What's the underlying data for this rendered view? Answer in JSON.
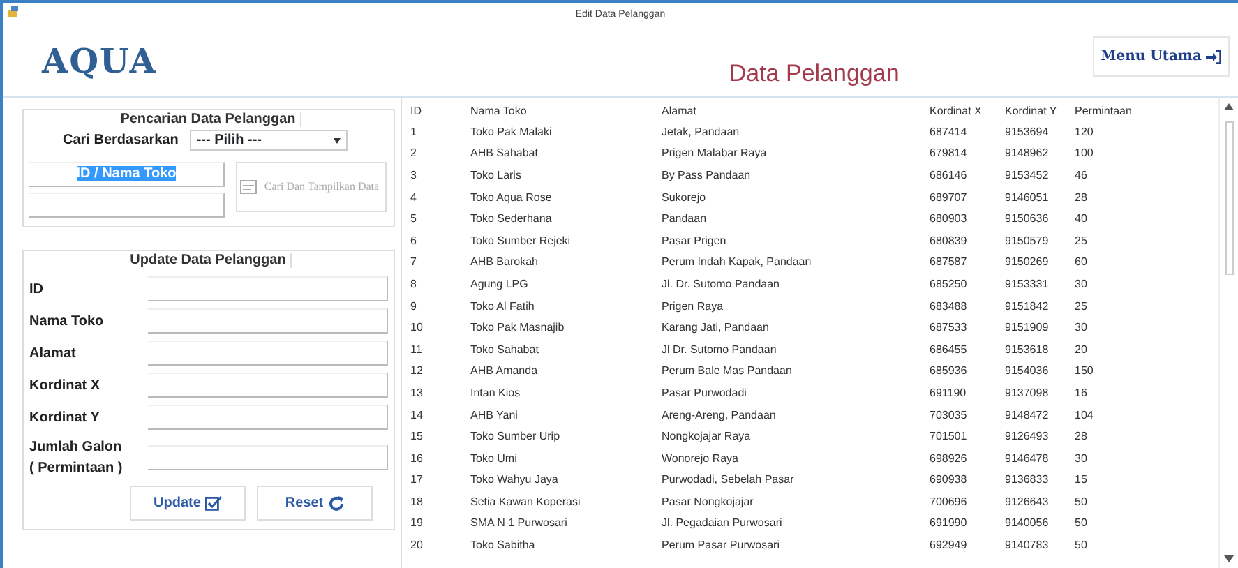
{
  "window": {
    "title": "Edit Data Pelanggan"
  },
  "header": {
    "logo": "AQUA",
    "heading": "Data Pelanggan",
    "menu_button": "Menu Utama"
  },
  "search": {
    "legend": "Pencarian Data Pelanggan",
    "by_label": "Cari Berdasarkan",
    "select_value": "--- Pilih ---",
    "field_value": "ID / Nama Toko",
    "field_selected": true,
    "button_label": "Cari Dan Tampilkan Data",
    "button_disabled": true
  },
  "update": {
    "legend": "Update Data Pelanggan",
    "fields": [
      {
        "label": "ID"
      },
      {
        "label": "Nama Toko"
      },
      {
        "label": "Alamat"
      },
      {
        "label": "Kordinat X"
      },
      {
        "label": "Kordinat Y"
      },
      {
        "label": "Jumlah Galon ( Permintaan )"
      }
    ],
    "buttons": [
      {
        "label": "Update",
        "kind": "update"
      },
      {
        "label": "Reset",
        "kind": "reset"
      }
    ]
  },
  "table": {
    "columns": [
      "ID",
      "Nama Toko",
      "Alamat",
      "Kordinat X",
      "Kordinat Y",
      "Permintaan"
    ],
    "rows": [
      [
        "1",
        "Toko Pak Malaki",
        "Jetak, Pandaan",
        "687414",
        "9153694",
        "120"
      ],
      [
        "2",
        "AHB Sahabat",
        "Prigen Malabar Raya",
        "679814",
        "9148962",
        "100"
      ],
      [
        "3",
        "Toko Laris",
        "By Pass Pandaan",
        "686146",
        "9153452",
        "46"
      ],
      [
        "4",
        "Toko Aqua Rose",
        "Sukorejo",
        "689707",
        "9146051",
        "28"
      ],
      [
        "5",
        "Toko Sederhana",
        "Pandaan",
        "680903",
        "9150636",
        "40"
      ],
      [
        "6",
        "Toko Sumber Rejeki",
        "Pasar Prigen",
        "680839",
        "9150579",
        "25"
      ],
      [
        "7",
        "AHB Barokah",
        "Perum Indah Kapak, Pandaan",
        "687587",
        "9150269",
        "60"
      ],
      [
        "8",
        "Agung LPG",
        "Jl. Dr. Sutomo Pandaan",
        "685250",
        "9153331",
        "30"
      ],
      [
        "9",
        "Toko Al Fatih",
        "Prigen Raya",
        "683488",
        "9151842",
        "25"
      ],
      [
        "10",
        "Toko Pak Masnajib",
        "Karang Jati, Pandaan",
        "687533",
        "9151909",
        "30"
      ],
      [
        "11",
        "Toko Sahabat",
        "Jl Dr. Sutomo Pandaan",
        "686455",
        "9153618",
        "20"
      ],
      [
        "12",
        "AHB Amanda",
        "Perum Bale Mas Pandaan",
        "685936",
        "9154036",
        "150"
      ],
      [
        "13",
        "Intan Kios",
        "Pasar Purwodadi",
        "691190",
        "9137098",
        "16"
      ],
      [
        "14",
        "AHB Yani",
        "Areng-Areng, Pandaan",
        "703035",
        "9148472",
        "104"
      ],
      [
        "15",
        "Toko Sumber Urip",
        "Nongkojajar Raya",
        "701501",
        "9126493",
        "28"
      ],
      [
        "16",
        "Toko Umi",
        "Wonorejo Raya",
        "698926",
        "9146478",
        "30"
      ],
      [
        "17",
        "Toko Wahyu Jaya",
        "Purwodadi, Sebelah Pasar",
        "690938",
        "9136833",
        "15"
      ],
      [
        "18",
        "Setia Kawan Koperasi",
        "Pasar Nongkojajar",
        "700696",
        "9126643",
        "50"
      ],
      [
        "19",
        "SMA N 1 Purwosari",
        "Jl. Pegadaian Purwosari",
        "691990",
        "9140056",
        "50"
      ],
      [
        "20",
        "Toko Sabitha",
        "Perum Pasar Purwosari",
        "692949",
        "9140783",
        "50"
      ]
    ]
  }
}
